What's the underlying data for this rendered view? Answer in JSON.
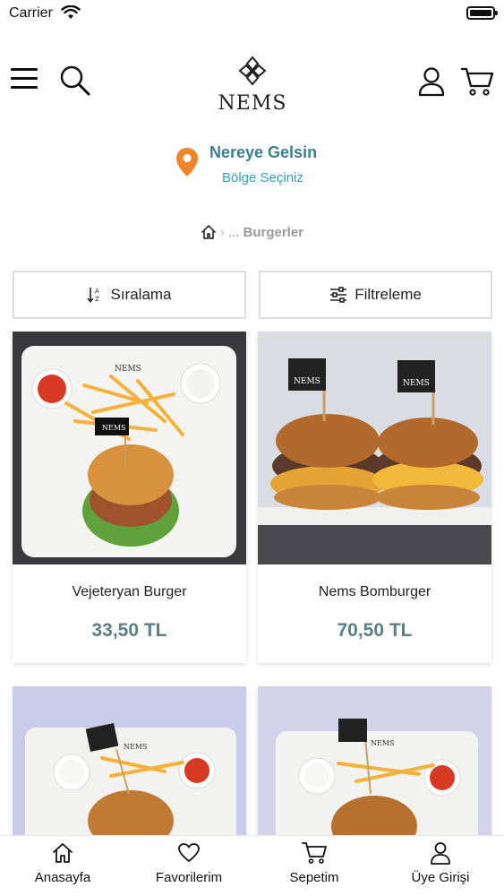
{
  "status_bar": {
    "carrier": "Carrier"
  },
  "header": {
    "logo_text": "NEMS"
  },
  "location": {
    "title": "Nereye Gelsin",
    "subtitle": "Bölge Seçiniz"
  },
  "breadcrumb": {
    "ellipsis": "...",
    "current": "Burgerler"
  },
  "actions": {
    "sort_label": "Sıralama",
    "filter_label": "Filtreleme"
  },
  "products": [
    {
      "name": "Vejeteryan Burger",
      "price": "33,50 TL"
    },
    {
      "name": "Nems Bomburger",
      "price": "70,50 TL"
    },
    {
      "name": "",
      "price": ""
    },
    {
      "name": "",
      "price": ""
    }
  ],
  "tabbar": {
    "home": "Anasayfa",
    "favorites": "Favorilerim",
    "cart": "Sepetim",
    "login": "Üye Girişi"
  },
  "colors": {
    "accent": "#3a7f8c",
    "link": "#2aa6b8",
    "price": "#5b7f87",
    "pin": "#f0862a"
  }
}
